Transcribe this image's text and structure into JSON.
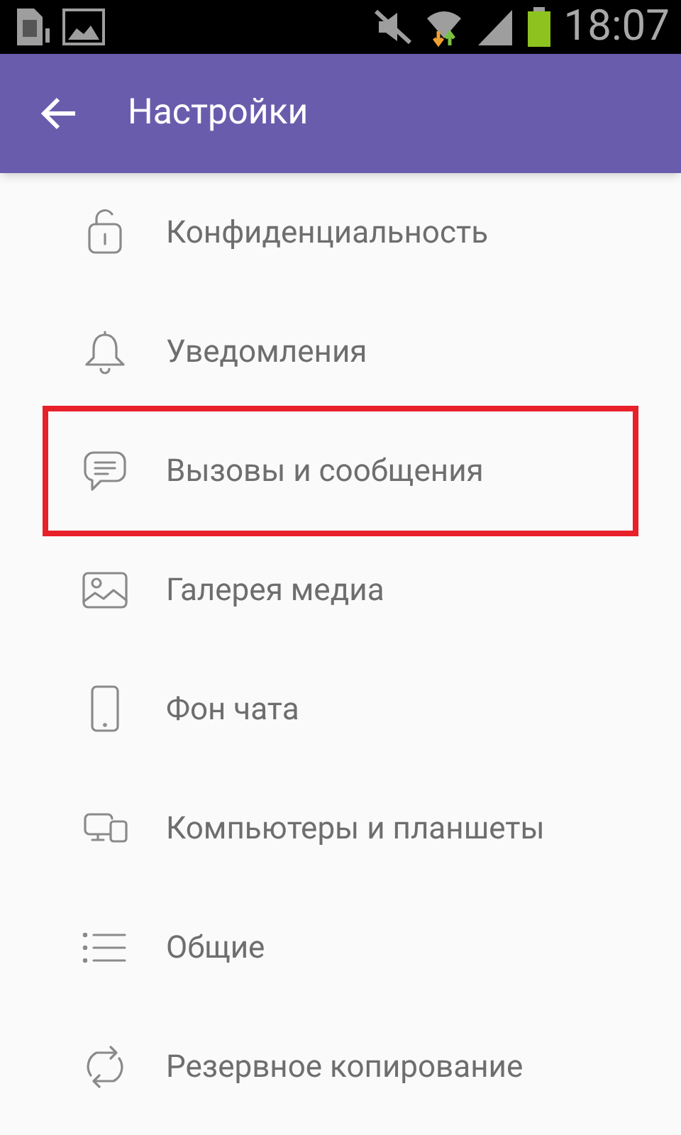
{
  "status_bar": {
    "time": "18:07"
  },
  "app_bar": {
    "title": "Настройки"
  },
  "items": [
    {
      "label": "Конфиденциальность",
      "highlighted": false
    },
    {
      "label": "Уведомления",
      "highlighted": false
    },
    {
      "label": "Вызовы и сообщения",
      "highlighted": true
    },
    {
      "label": "Галерея медиа",
      "highlighted": false
    },
    {
      "label": "Фон чата",
      "highlighted": false
    },
    {
      "label": "Компьютеры и планшеты",
      "highlighted": false
    },
    {
      "label": "Общие",
      "highlighted": false
    },
    {
      "label": "Резервное копирование",
      "highlighted": false
    }
  ]
}
